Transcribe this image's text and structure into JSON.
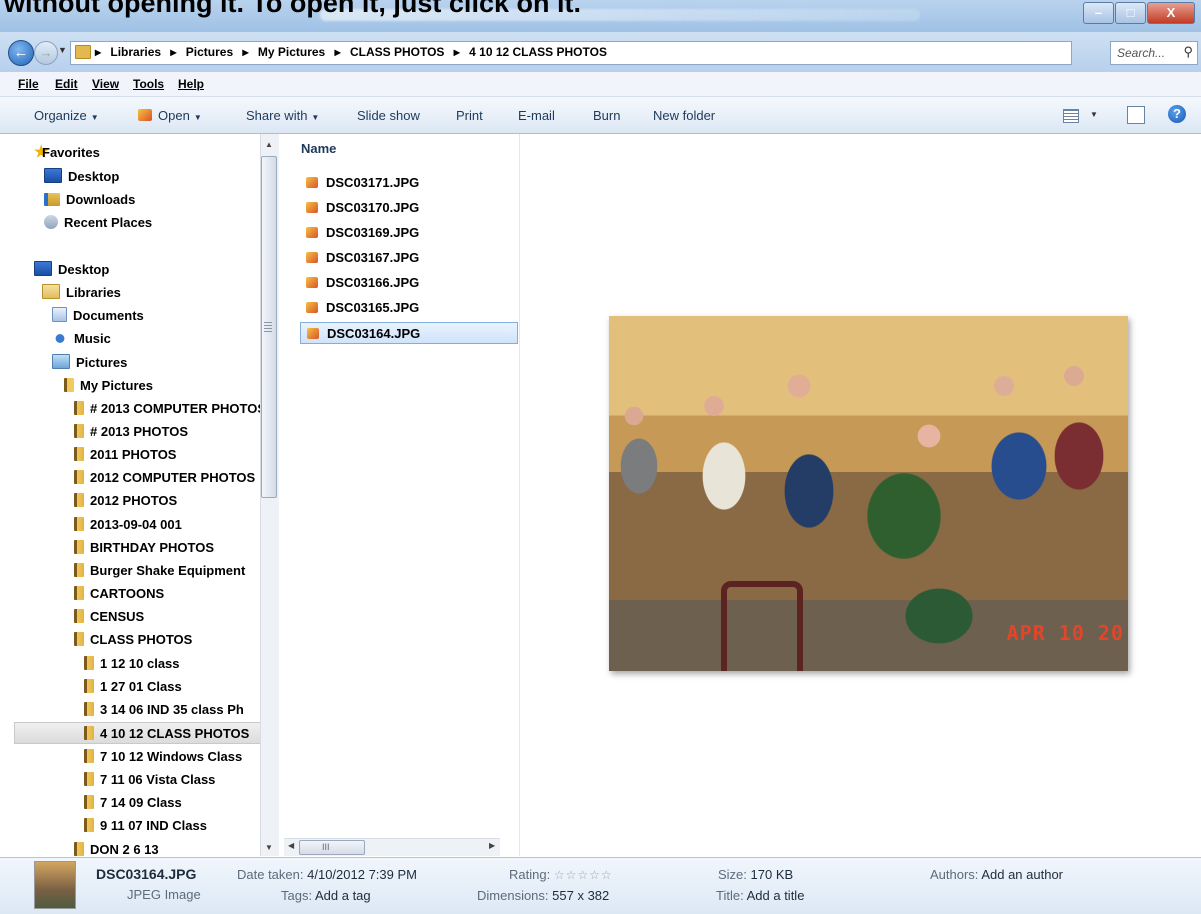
{
  "doc_caption": "without opening it. To open it, just click on it.",
  "window": {
    "minimize": "–",
    "maximize": "□",
    "close": "X"
  },
  "address": {
    "breadcrumbs": [
      "▸",
      "Libraries",
      "▸",
      "Pictures",
      "▸",
      "My Pictures",
      "▸",
      "CLASS PHOTOS",
      "▸",
      "4 10 12 CLASS PHOTOS"
    ],
    "search_placeholder": "Search..."
  },
  "menu": [
    "File",
    "Edit",
    "View",
    "Tools",
    "Help"
  ],
  "toolbar": {
    "organize": "Organize",
    "open": "Open",
    "share_with": "Share with",
    "slide_show": "Slide show",
    "print": "Print",
    "email": "E-mail",
    "burn": "Burn",
    "new_folder": "New folder"
  },
  "nav_tree": [
    {
      "label": "Favorites",
      "icon": "star-icon"
    },
    {
      "label": "Desktop",
      "icon": "desktop-icon"
    },
    {
      "label": "Downloads",
      "icon": "downloads-icon"
    },
    {
      "label": "Recent Places",
      "icon": "recent-places-icon"
    },
    {
      "label": "Desktop",
      "icon": "desktop-icon"
    },
    {
      "label": "Libraries",
      "icon": "libraries-icon"
    },
    {
      "label": "Documents",
      "icon": "documents-icon"
    },
    {
      "label": "Music",
      "icon": "music-icon"
    },
    {
      "label": "Pictures",
      "icon": "pictures-icon"
    },
    {
      "label": "My Pictures",
      "icon": "folder-icon"
    },
    {
      "label": "# 2013 COMPUTER PHOTOS",
      "icon": "folder-icon"
    },
    {
      "label": "# 2013 PHOTOS",
      "icon": "folder-icon"
    },
    {
      "label": "2011 PHOTOS",
      "icon": "folder-icon"
    },
    {
      "label": "2012 COMPUTER PHOTOS",
      "icon": "folder-icon"
    },
    {
      "label": "2012 PHOTOS",
      "icon": "folder-icon"
    },
    {
      "label": "2013-09-04 001",
      "icon": "folder-icon"
    },
    {
      "label": "BIRTHDAY PHOTOS",
      "icon": "folder-icon"
    },
    {
      "label": "Burger Shake Equipment",
      "icon": "folder-icon"
    },
    {
      "label": "CARTOONS",
      "icon": "folder-icon"
    },
    {
      "label": "CENSUS",
      "icon": "folder-icon"
    },
    {
      "label": "CLASS PHOTOS",
      "icon": "folder-icon"
    },
    {
      "label": "1 12 10 class",
      "icon": "folder-icon"
    },
    {
      "label": "1 27 01 Class",
      "icon": "folder-icon"
    },
    {
      "label": "3 14 06  IND 35 class Ph",
      "icon": "folder-icon"
    },
    {
      "label": "4 10 12 CLASS PHOTOS",
      "icon": "folder-icon"
    },
    {
      "label": "7 10 12 Windows Class",
      "icon": "folder-icon"
    },
    {
      "label": "7 11 06 Vista Class",
      "icon": "folder-icon"
    },
    {
      "label": "7 14 09 Class",
      "icon": "folder-icon"
    },
    {
      "label": "9 11 07 IND Class",
      "icon": "folder-icon"
    },
    {
      "label": "DON 2 6 13",
      "icon": "folder-icon"
    }
  ],
  "file_list": {
    "column_header": "Name",
    "files": [
      "DSC03171.JPG",
      "DSC03170.JPG",
      "DSC03169.JPG",
      "DSC03167.JPG",
      "DSC03166.JPG",
      "DSC03165.JPG",
      "DSC03164.JPG"
    ],
    "selected": "DSC03164.JPG",
    "scroll_grip": "III"
  },
  "preview": {
    "date_stamp": "APR 10 20"
  },
  "details": {
    "file_name": "DSC03164.JPG",
    "file_type": "JPEG Image",
    "date_taken_label": "Date taken:",
    "date_taken": "4/10/2012 7:39 PM",
    "tags_label": "Tags:",
    "tags": "Add a tag",
    "rating_label": "Rating:",
    "rating_stars": "☆☆☆☆☆",
    "dimensions_label": "Dimensions:",
    "dimensions": "557 x 382",
    "size_label": "Size:",
    "size": "170 KB",
    "title_label": "Title:",
    "title": "Add a title",
    "authors_label": "Authors:",
    "authors": "Add an author"
  }
}
